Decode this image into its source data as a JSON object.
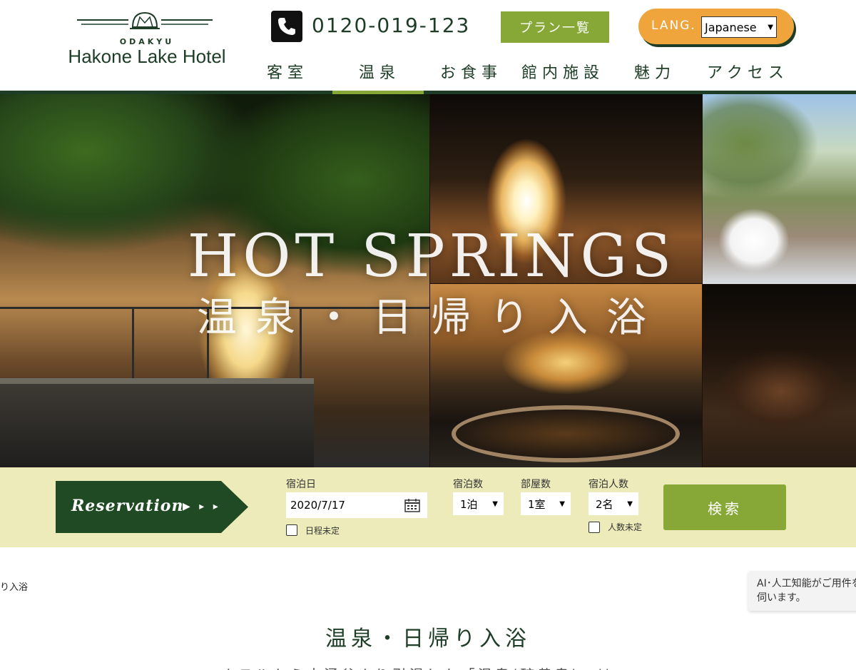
{
  "header": {
    "logo": {
      "brand": "ODAKYU",
      "name": "Hakone Lake Hotel"
    },
    "phone": {
      "icon": "phone-icon",
      "number": "0120-019-123"
    },
    "plan_button": "プラン一覧",
    "lang": {
      "label": "LANG.",
      "selected": "Japanese"
    },
    "nav": [
      "客室",
      "温泉",
      "お食事",
      "館内施設",
      "魅力",
      "アクセス"
    ],
    "active_nav": "温泉"
  },
  "hero": {
    "title_en": "HOT SPRINGS",
    "title_ja": "温泉・日帰り入浴"
  },
  "reservation": {
    "badge": "Reservation",
    "badge_arrows": "▶ ▸ ▸",
    "date_label": "宿泊日",
    "date_value": "2020/7/17",
    "date_undecided": "日程未定",
    "nights_label": "宿泊数",
    "nights_value": "1泊",
    "rooms_label": "部屋数",
    "rooms_value": "1室",
    "guests_label": "宿泊人数",
    "guests_value": "2名",
    "guests_undecided": "人数未定",
    "search_button": "検索"
  },
  "breadcrumb": "り入浴",
  "ai_notice": "AI･人工知能がご用件を伺います。",
  "page_title": "温泉・日帰り入浴",
  "intro_partial": "ホテルから大涌谷より引湯した「温泉(硫黄泉)」は",
  "colors": {
    "brand_green": "#1d3d26",
    "accent_green": "#87a836",
    "lang_orange": "#f0a53c",
    "res_bar": "#ecebb9"
  }
}
